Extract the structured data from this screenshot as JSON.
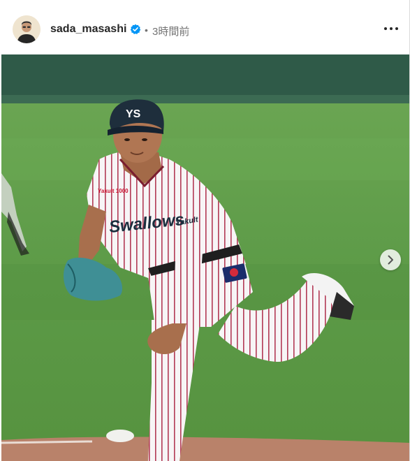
{
  "post": {
    "username": "sada_masashi",
    "time_ago": "3時間前",
    "separator": "•",
    "verified": true,
    "verified_icon": "verified-badge-icon",
    "more_icon": "more-options-icon",
    "next_icon": "chevron-right-icon"
  },
  "photo": {
    "jersey_wordmark": "Swallows",
    "sponsor_text": "Yakult",
    "sleeve_patch": "Yakult 1000",
    "cap_logo": "YS"
  },
  "colors": {
    "accent_verified": "#0095f6",
    "text_primary": "#262626",
    "text_secondary": "#737373"
  }
}
